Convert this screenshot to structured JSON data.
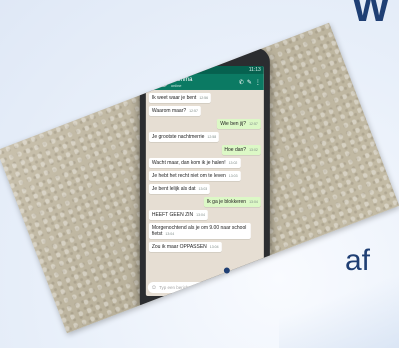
{
  "slide": {
    "heading_partial": "W",
    "bullet_symbol": "•",
    "bullet_text": "af"
  },
  "chat": {
    "contact_name": "Mamma",
    "contact_status": "online",
    "status_time": "11:13",
    "messages": [
      {
        "dir": "in",
        "text": "Ik weet waar je bent",
        "time": "12:56"
      },
      {
        "dir": "in",
        "text": "Waarom maar?",
        "time": "12:57"
      },
      {
        "dir": "out",
        "text": "Wie ben jij?",
        "time": "12:57"
      },
      {
        "dir": "in",
        "text": "Je grootste nachtmerrie",
        "time": "12:58"
      },
      {
        "dir": "out",
        "text": "Hoe dan?",
        "time": "13:02"
      },
      {
        "dir": "in",
        "text": "Wacht maar, dan kom ik je halen!",
        "time": "13:02"
      },
      {
        "dir": "in",
        "text": "Je hebt het recht niet om te leven",
        "time": "13:03"
      },
      {
        "dir": "in",
        "text": "Je bent lelijk als dat",
        "time": "13:03"
      },
      {
        "dir": "out",
        "text": "Ik ga je blokkeren",
        "time": "13:04"
      },
      {
        "dir": "in",
        "text": "HEEFT GEEN ZIN",
        "time": "13:04"
      },
      {
        "dir": "in",
        "text": "Morgenochtend als je om 9.00 naar school fietst",
        "time": "13:04"
      },
      {
        "dir": "in",
        "text": "Zou ik maar OPPASSEN",
        "time": "13:04"
      }
    ],
    "input_placeholder": "Typ een bericht",
    "icons": {
      "back": "arrow-left-icon",
      "call": "phone-icon",
      "attach": "paperclip-icon",
      "menu": "more-icon",
      "emoji": "emoji-icon",
      "mic": "mic-icon"
    }
  },
  "colors": {
    "whatsapp_green": "#0b7a63",
    "outgoing_bubble": "#dcf8c6",
    "slide_text": "#1f3f74"
  }
}
